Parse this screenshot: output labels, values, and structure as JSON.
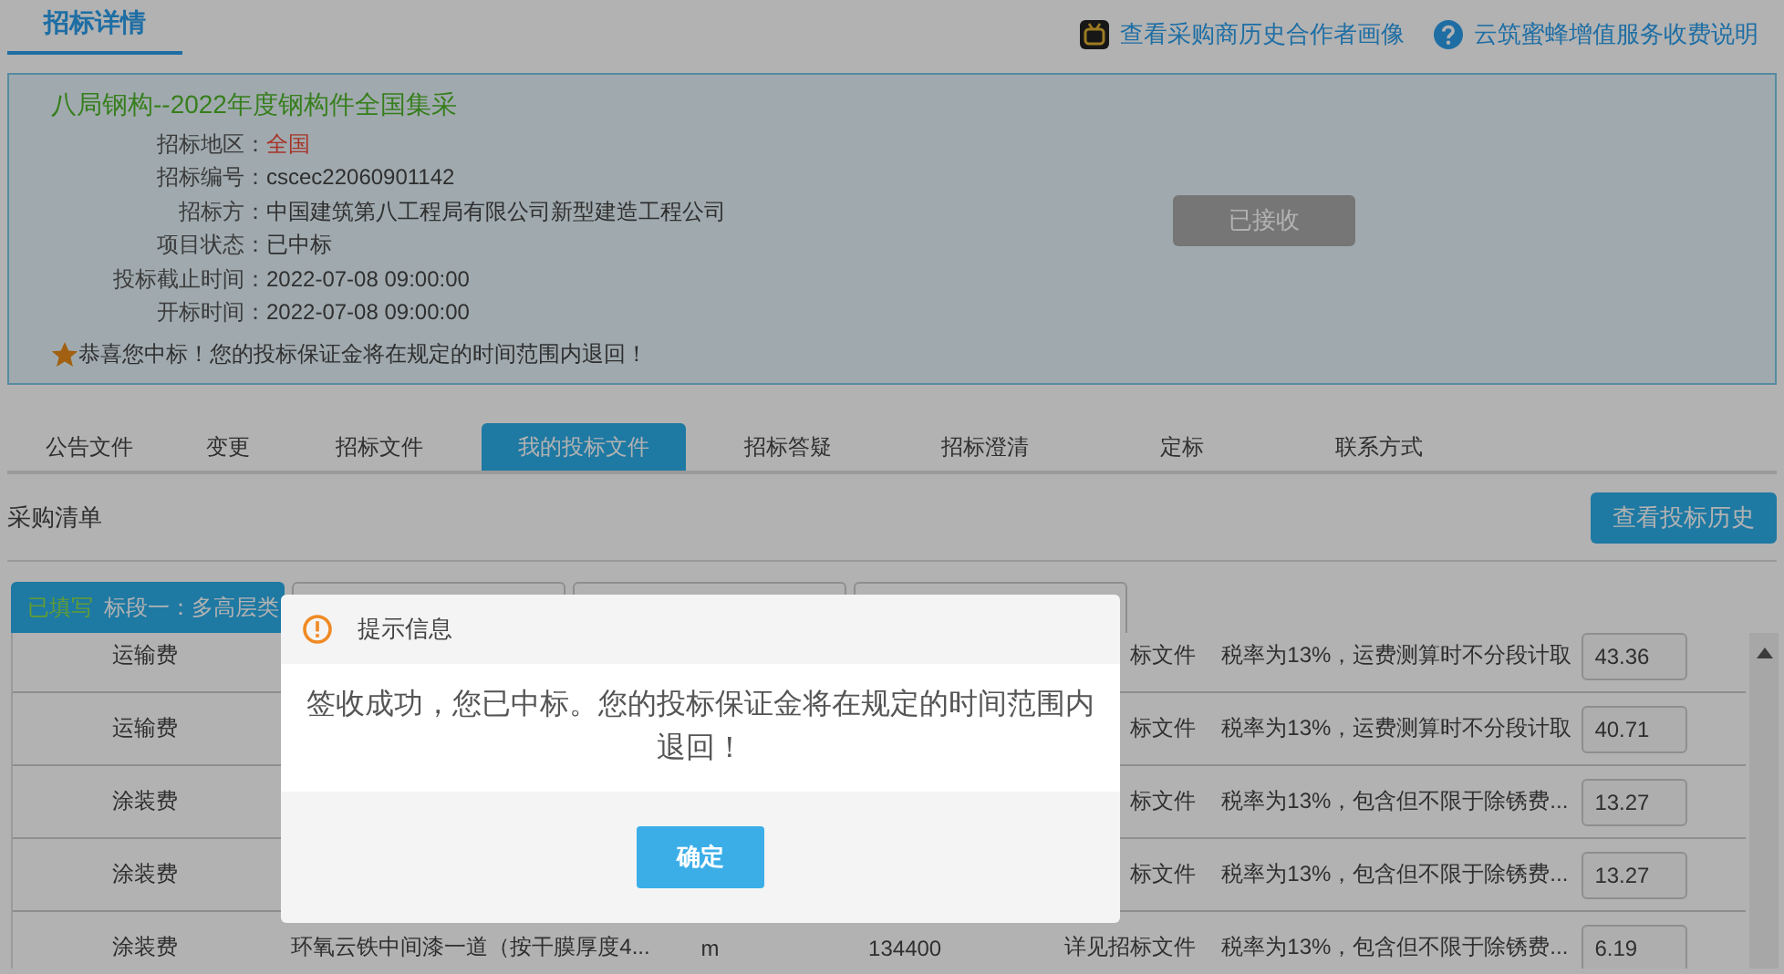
{
  "header": {
    "title": "招标详情",
    "links": [
      {
        "kind": "tv",
        "label": "查看采购商历史合作者画像"
      },
      {
        "kind": "help",
        "label": "云筑蜜蜂增值服务收费说明"
      }
    ]
  },
  "tender": {
    "title": "八局钢构--2022年度钢构件全国集采",
    "fields": [
      {
        "label": "招标地区：",
        "value": "全国",
        "highlight": true
      },
      {
        "label": "招标编号：",
        "value": "cscec22060901142",
        "highlight": false
      },
      {
        "label": "招标方：",
        "value": "中国建筑第八工程局有限公司新型建造工程公司",
        "highlight": false
      },
      {
        "label": "项目状态：",
        "value": "已中标",
        "highlight": false
      },
      {
        "label": "投标截止时间：",
        "value": "2022-07-08 09:00:00",
        "highlight": false
      },
      {
        "label": "开标时间：",
        "value": "2022-07-08 09:00:00",
        "highlight": false
      }
    ],
    "action": {
      "label": "已接收",
      "disabled": true
    },
    "notice": "恭喜您中标！您的投标保证金将在规定的时间范围内退回！"
  },
  "tabs": [
    {
      "label": "公告文件",
      "selected": false
    },
    {
      "label": "变更",
      "selected": false
    },
    {
      "label": "招标文件",
      "selected": false
    },
    {
      "label": "我的投标文件",
      "selected": true
    },
    {
      "label": "招标答疑",
      "selected": false
    },
    {
      "label": "招标澄清",
      "selected": false
    },
    {
      "label": "定标",
      "selected": false
    },
    {
      "label": "联系方式",
      "selected": false
    }
  ],
  "purchase_list": {
    "title": "采购清单",
    "history_button": "查看投标历史",
    "sections": [
      {
        "status": "已填写",
        "label": "标段一：多高层类",
        "selected": true
      },
      {
        "selected": false
      },
      {
        "selected": false
      },
      {
        "selected": false
      }
    ],
    "rows": [
      {
        "name": "运输费",
        "file": "标文件",
        "note": "税率为13%，运费测算时不分段计取",
        "price": "43.36"
      },
      {
        "name": "运输费",
        "file": "标文件",
        "note": "税率为13%，运费测算时不分段计取",
        "price": "40.71"
      },
      {
        "name": "涂装费",
        "file": "标文件",
        "note": "税率为13%，包含但不限于除锈费...",
        "price": "13.27"
      },
      {
        "name": "涂装费",
        "file": "标文件",
        "note": "税率为13%，包含但不限于除锈费...",
        "price": "13.27"
      },
      {
        "name": "涂装费",
        "description": "环氧云铁中间漆一道（按干膜厚度4...",
        "unit": "m",
        "quantity": "134400",
        "file": "详见招标文件",
        "note": "税率为13%，包含但不限于除锈费...",
        "price": "6.19"
      }
    ]
  },
  "dialog": {
    "title": "提示信息",
    "message": "签收成功，您已中标。您的投标保证金将在规定的时间范围内退回！",
    "button": "确定"
  }
}
